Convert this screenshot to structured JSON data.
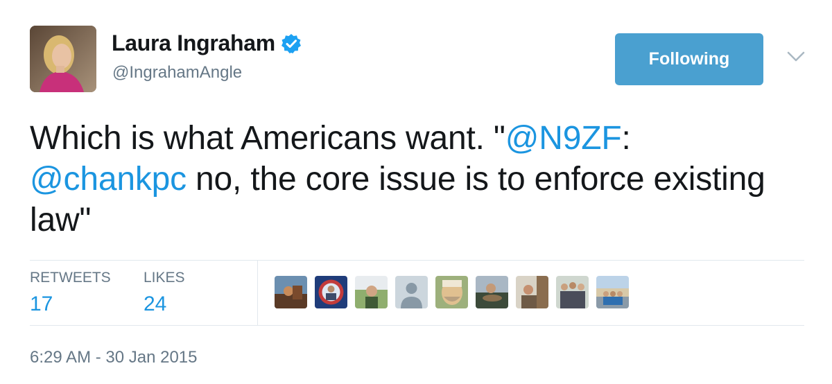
{
  "author": {
    "name": "Laura Ingraham",
    "handle": "@IngrahamAngle",
    "verified": true
  },
  "follow_button": {
    "label": "Following"
  },
  "tweet": {
    "segments": [
      {
        "text": "Which is what Americans want. \"",
        "type": "text"
      },
      {
        "text": "@N9ZF",
        "type": "mention"
      },
      {
        "text": ":",
        "type": "text"
      },
      {
        "text": "@chankpc",
        "type": "mention"
      },
      {
        "text": " no, the core issue is to enforce existing law\"",
        "type": "text"
      }
    ]
  },
  "stats": {
    "retweets_label": "RETWEETS",
    "retweets_count": "17",
    "likes_label": "LIKES",
    "likes_count": "24"
  },
  "likers": [
    {
      "name": "liker-avatar-1"
    },
    {
      "name": "liker-avatar-2"
    },
    {
      "name": "liker-avatar-3"
    },
    {
      "name": "liker-avatar-4"
    },
    {
      "name": "liker-avatar-5"
    },
    {
      "name": "liker-avatar-6"
    },
    {
      "name": "liker-avatar-7"
    },
    {
      "name": "liker-avatar-8"
    },
    {
      "name": "liker-avatar-9"
    }
  ],
  "timestamp": "6:29 AM - 30 Jan 2015",
  "colors": {
    "accent": "#1b95e0",
    "button": "#4aa0d0",
    "muted": "#657786"
  }
}
